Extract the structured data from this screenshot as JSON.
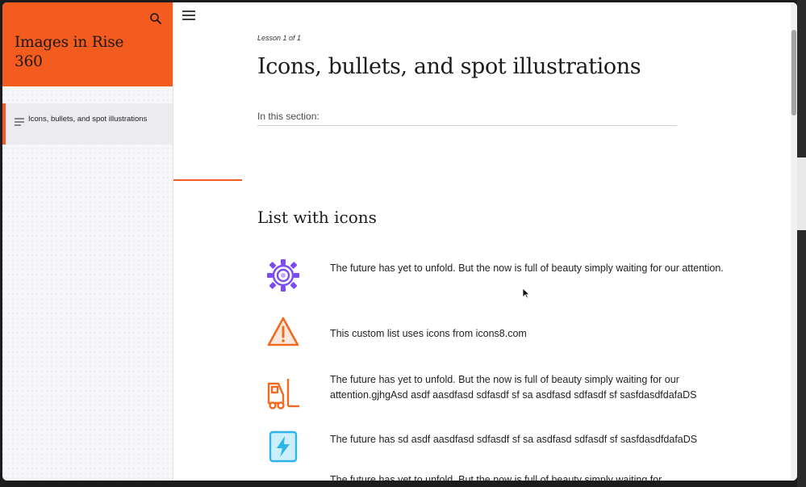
{
  "sidebar": {
    "course_title": "Images in Rise 360",
    "lessons": [
      {
        "label": "Icons, bullets, and spot illustrations",
        "active": true
      }
    ]
  },
  "main": {
    "lesson_counter": "Lesson 1 of 1",
    "lesson_title": "Icons, bullets, and spot illustrations",
    "section_label": "In this section:",
    "block_heading": "List with icons",
    "items": [
      {
        "icon": "gear-icon",
        "text": "The future has yet to unfold. But the now is full of beauty simply waiting for our attention."
      },
      {
        "icon": "warning-icon",
        "text": "This custom list uses icons from icons8.com"
      },
      {
        "icon": "forklift-icon",
        "text": "The future has yet to unfold. But the now is full of beauty simply waiting for our attention.gjhgAsd asdf aasdfasd sdfasdf sf sa asdfasd sdfasdf sf sasfdasdfdafaDS"
      },
      {
        "icon": "lightning-icon",
        "text": "The future has sd asdf aasdfasd sdfasdf sf sa asdfasd sdfasdf sf sasfdasdfdafaDS"
      },
      {
        "icon": "text-fragment",
        "text": "The future has yet to unfold. But the now is full of beauty simply waiting for"
      }
    ]
  },
  "colors": {
    "accent": "#f35b1f",
    "gear": "#7b4cf0",
    "warning": "#f06a21",
    "lightning": "#2bb5e8"
  }
}
